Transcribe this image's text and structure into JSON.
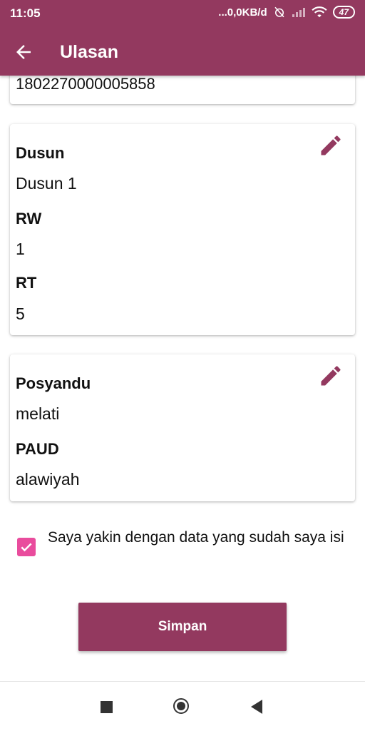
{
  "status_bar": {
    "time": "11:05",
    "network_speed": "...0,0KB/d",
    "battery": "47"
  },
  "toolbar": {
    "title": "Ulasan"
  },
  "identity_card": {
    "nik": "1802270000005858"
  },
  "address_card": {
    "dusun_label": "Dusun",
    "dusun_value": "Dusun 1",
    "rw_label": "RW",
    "rw_value": "1",
    "rt_label": "RT",
    "rt_value": "5"
  },
  "facility_card": {
    "posyandu_label": "Posyandu",
    "posyandu_value": "melati",
    "paud_label": "PAUD",
    "paud_value": "alawiyah"
  },
  "confirmation": {
    "checked": true,
    "text": "Saya yakin dengan data yang sudah saya isi"
  },
  "save_button": {
    "label": "Simpan"
  },
  "colors": {
    "primary": "#93395f",
    "checkbox": "#e94c9d"
  },
  "icons": {
    "back": "arrow-left-icon",
    "edit": "pencil-icon"
  }
}
